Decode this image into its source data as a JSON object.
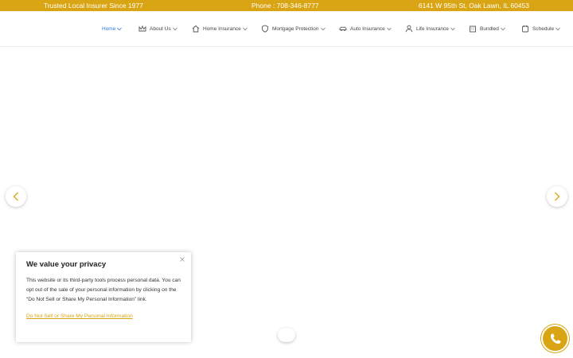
{
  "topbar": {
    "tagline": "Trusted Local Insurer Since 1977",
    "phone": "Phone : 708-346-8777",
    "address": "6141 W 95th St, Oak Lawn, IL 60453"
  },
  "nav": {
    "items": [
      {
        "label": "Home",
        "icon": "none"
      },
      {
        "label": "About Us",
        "icon": "crown-icon"
      },
      {
        "label": "Home Insurance",
        "icon": "house-icon"
      },
      {
        "label": "Mortgage Protection",
        "icon": "shield-icon"
      },
      {
        "label": "Auto Insurance",
        "icon": "car-icon"
      },
      {
        "label": "Life Insurance",
        "icon": "person-icon"
      },
      {
        "label": "Bundled",
        "icon": "building-icon"
      },
      {
        "label": "Schedule",
        "icon": "calendar-icon"
      }
    ]
  },
  "privacy": {
    "title": "We value your privacy",
    "body": "This website or its third-party tools process personal data. You can opt out of the sale of your personal information by clicking on the “Do Not Sell or Share My Personal Information” link.",
    "link": "Do Not Sell or Share My Personal Information"
  },
  "colors": {
    "accent": "#d9a514",
    "nav_active": "#2d7ad6"
  }
}
